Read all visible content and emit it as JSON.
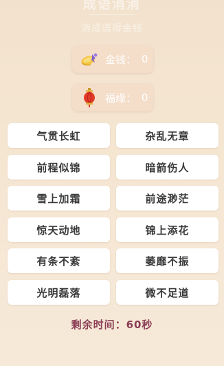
{
  "header": {
    "title": "成语消消",
    "subtitle": "消成语得金钱"
  },
  "stats": {
    "coins": {
      "icon": "coin-pouch-icon",
      "label": "金钱：",
      "value": "0"
    },
    "luck": {
      "icon": "red-lantern-icon",
      "label": "福缘：",
      "value": "0"
    }
  },
  "board": {
    "cards": [
      "气贯长虹",
      "杂乱无章",
      "前程似锦",
      "暗箭伤人",
      "雪上加霜",
      "前途渺茫",
      "惊天动地",
      "锦上添花",
      "有条不紊",
      "萎靡不振",
      "光明磊落",
      "微不足道"
    ]
  },
  "timer": {
    "text": "剩余时间：60秒"
  },
  "colors": {
    "background": "#f4e5d2",
    "card": "#ffffff",
    "card_text": "#3a3a3a",
    "stat_box": "#f4ddc9",
    "timer_text": "#8a3d55"
  }
}
